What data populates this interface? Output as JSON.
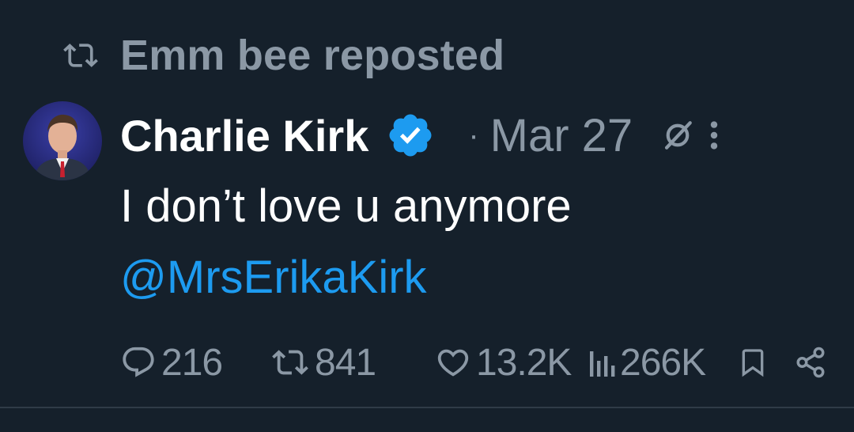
{
  "repost": {
    "icon": "repost-icon",
    "text": "Emm bee reposted"
  },
  "tweet": {
    "author": {
      "display_name": "Charlie Kirk",
      "verified_icon": "verified-badge-icon",
      "avatar": "avatar"
    },
    "separator": "·",
    "date": "Mar 27",
    "grok_icon": "grok-icon",
    "more_icon": "more-options-icon",
    "text": "I don’t love u anymore",
    "mention": "@MrsErikaKirk",
    "actions": {
      "replies": "216",
      "reposts": "841",
      "likes": "13.2K",
      "views": "266K"
    }
  },
  "colors": {
    "background": "#15202b",
    "secondary_text": "#8b98a5",
    "primary_text": "#ffffff",
    "link": "#1d9bf0",
    "verified": "#1d9bf0"
  }
}
